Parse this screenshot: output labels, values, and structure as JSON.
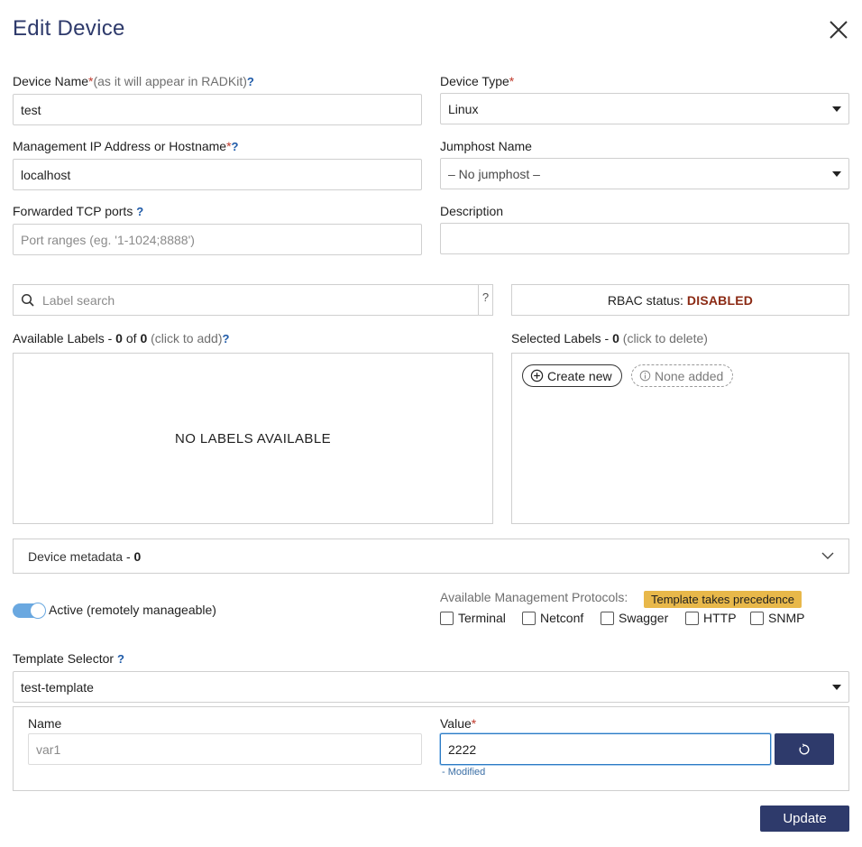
{
  "dialog": {
    "title": "Edit Device"
  },
  "fields": {
    "device_name": {
      "label": "Device Name",
      "required_mark": "*",
      "hint": "(as it will appear in RADKit)",
      "help": "?",
      "value": "test"
    },
    "device_type": {
      "label": "Device Type",
      "required_mark": "*",
      "value": "Linux"
    },
    "management_ip": {
      "label": "Management IP Address or Hostname",
      "required_mark": "*",
      "help": "?",
      "value": "localhost"
    },
    "jumphost": {
      "label": "Jumphost Name",
      "value": "– No jumphost –"
    },
    "forwarded_ports": {
      "label": "Forwarded TCP ports",
      "help": "?",
      "placeholder": "Port ranges (eg. '1-1024;8888')",
      "value": ""
    },
    "description": {
      "label": "Description",
      "value": ""
    }
  },
  "labels": {
    "search_placeholder": "Label search",
    "search_help": "?",
    "rbac_label": "RBAC status:",
    "rbac_value": "DISABLED",
    "available": {
      "title": "Available Labels",
      "sep": "-",
      "count": "0",
      "of": "of",
      "total": "0",
      "hint": "(click to add)",
      "help": "?",
      "empty_text": "NO LABELS AVAILABLE"
    },
    "selected": {
      "title": "Selected Labels",
      "sep": "-",
      "count": "0",
      "hint": "(click to delete)",
      "create_label": "Create new",
      "none_label": "None added"
    }
  },
  "metadata": {
    "label": "Device metadata",
    "sep": "-",
    "count": "0"
  },
  "active": {
    "label": "Active (remotely manageable)",
    "on": true
  },
  "protocols": {
    "label": "Available Management Protocols:",
    "badge": "Template takes precedence",
    "items": [
      {
        "label": "Terminal",
        "checked": false
      },
      {
        "label": "Netconf",
        "checked": false
      },
      {
        "label": "Swagger",
        "checked": false
      },
      {
        "label": "HTTP",
        "checked": false
      },
      {
        "label": "SNMP",
        "checked": false
      }
    ]
  },
  "template": {
    "label": "Template Selector",
    "help": "?",
    "value": "test-template",
    "name_header": "Name",
    "value_header": "Value",
    "required_mark": "*",
    "var_name": "var1",
    "var_value": "2222",
    "modified_text": "- Modified"
  },
  "actions": {
    "update_label": "Update"
  },
  "colors": {
    "primary": "#2e3a6b",
    "required": "#c0392b",
    "rbac_disabled": "#8b2a14",
    "badge": "#e8b84a",
    "toggle_on": "#6aa8e0",
    "help": "#1e5aa8"
  }
}
